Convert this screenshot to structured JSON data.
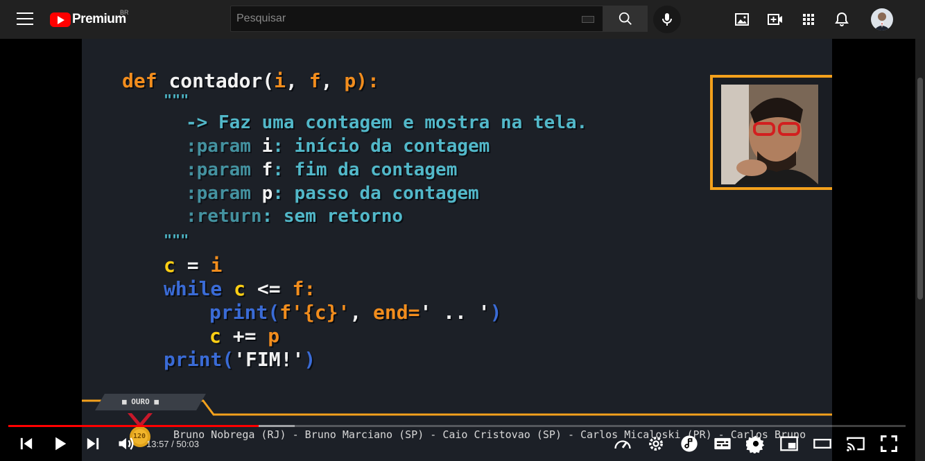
{
  "header": {
    "logo_text": "Premium",
    "country_code": "BR",
    "search_placeholder": "Pesquisar"
  },
  "video": {
    "code_line1": {
      "def": "def",
      "name": "contador(",
      "p1": "i",
      "c1": ", ",
      "p2": "f",
      "c2": ", ",
      "p3": "p",
      "end": "):"
    },
    "docquote_open": "\"\"\"",
    "doc_line1": "-> Faz uma contagem e mostra na tela.",
    "doc_param1": {
      "tag": ":param",
      "name": "i",
      "desc": ": início da contagem"
    },
    "doc_param2": {
      "tag": ":param",
      "name": "f",
      "desc": ": fim da contagem"
    },
    "doc_param3": {
      "tag": ":param",
      "name": "p",
      "desc": ": passo da contagem"
    },
    "doc_return": {
      "tag": ":return",
      "desc": ": sem retorno"
    },
    "docquote_close": "\"\"\"",
    "line_assign": {
      "var": "c",
      "op": " = ",
      "val": "i"
    },
    "line_while": {
      "kw": "while",
      "var": "c",
      "op": " <= ",
      "val": "f",
      "end": ":"
    },
    "line_print1": {
      "fn": "print(",
      "arg": "f'{c}'",
      "sep": ", ",
      "kw": "end=",
      "str": "' .. '",
      "close": ")"
    },
    "line_incr": {
      "var": "c",
      "op": " += ",
      "val": "p"
    },
    "line_print2": {
      "fn": "print(",
      "str": "'FIM!'",
      "close": ")"
    },
    "medal_label": "■ OURO ■",
    "medal_number": "120",
    "ticker_text": "Bruno Nobrega (RJ) - Bruno Marciano (SP) - Caio Cristovao (SP) - Carlos Micaloski (PR) - Carlos Bruno"
  },
  "player": {
    "current_time": "13:57",
    "duration": "50:03",
    "time_separator": " / ",
    "progress_fraction": 0.279,
    "buffer_fraction": 0.319
  },
  "colors": {
    "progress_played": "#ff0000",
    "code_orange": "#f28d1d",
    "code_cyan": "#4fbccc",
    "code_yellow": "#ffcf14",
    "code_blue": "#3a6bd6",
    "cam_border": "#f4a11c"
  },
  "icons": {
    "top_right": [
      "image-icon",
      "create-video-icon",
      "apps-grid-icon",
      "notifications-bell-icon"
    ],
    "controls": [
      "previous-icon",
      "play-icon",
      "next-icon",
      "volume-icon",
      "speed-icon",
      "settings-gear-icon",
      "music-icon",
      "subtitles-icon",
      "miniplayer-icon",
      "theater-mode-icon",
      "cast-icon",
      "fullscreen-icon"
    ]
  }
}
